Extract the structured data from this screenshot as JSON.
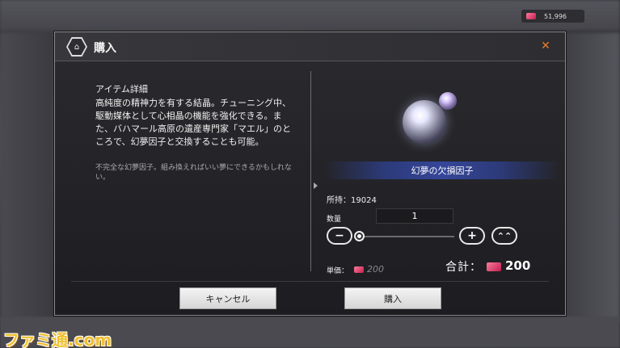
{
  "background": {
    "currency_amount": "51,996"
  },
  "dialog": {
    "title": "購入",
    "header_icon": "shop-icon",
    "close_icon": "close-icon",
    "accent_color": "#e87a2a"
  },
  "details": {
    "heading": "アイテム詳細",
    "description": "高純度の精神力を有する結晶。チューニング中、駆動媒体として心相晶の機能を強化できる。また、バハマール高原の遺産専門家「マエル」のところで、幻夢因子と交換することも可能。",
    "flavor": "不完全な幻夢因子。組み換えればいい夢にできるかもしれない。"
  },
  "item": {
    "name": "幻夢の欠損因子",
    "owned_label": "所持：",
    "owned_count": "19024"
  },
  "purchase": {
    "quantity_label": "数量",
    "quantity": "1",
    "minus_symbol": "−",
    "plus_symbol": "+",
    "max_symbol": "⌃⌃",
    "unit_price_label": "単価：",
    "unit_price": "200",
    "total_label": "合計：",
    "total": "200",
    "slider_level": 0
  },
  "buttons": {
    "cancel": "キャンセル",
    "buy": "購入"
  },
  "watermark": "ファミ通.com"
}
